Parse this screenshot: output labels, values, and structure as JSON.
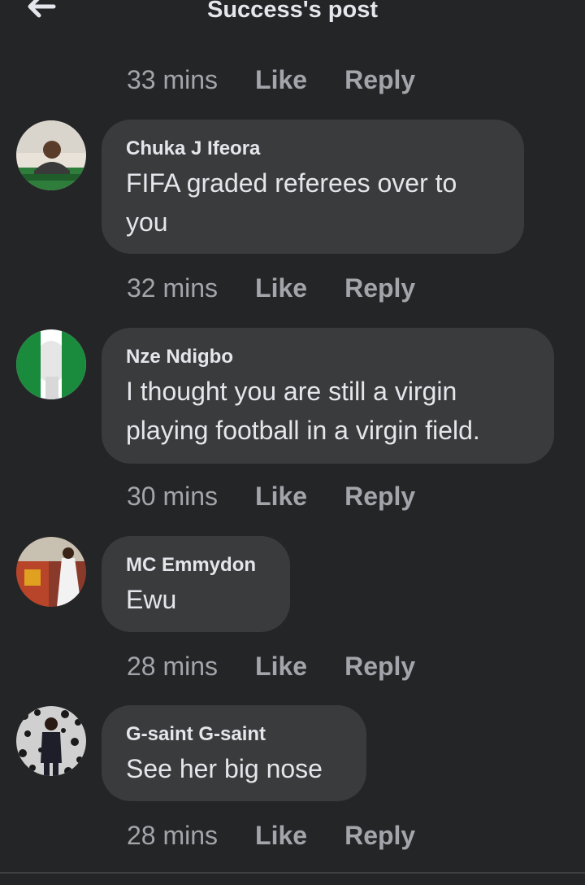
{
  "header": {
    "title": "Success's post",
    "back_icon": "arrow-left-icon"
  },
  "top_meta": {
    "time": "33 mins",
    "like": "Like",
    "reply": "Reply"
  },
  "comments": [
    {
      "author": "Chuka J Ifeora",
      "text_lines": [
        "FIFA graded referees over to",
        "you"
      ],
      "time": "32 mins",
      "like": "Like",
      "reply": "Reply"
    },
    {
      "author": "Nze Ndigbo",
      "text_lines": [
        "I thought you are still a virgin",
        "playing football in a virgin field."
      ],
      "time": "30 mins",
      "like": "Like",
      "reply": "Reply"
    },
    {
      "author": "MC Emmydon",
      "text_lines": [
        "Ewu"
      ],
      "time": "28 mins",
      "like": "Like",
      "reply": "Reply"
    },
    {
      "author": "G-saint G-saint",
      "text_lines": [
        "See her big nose"
      ],
      "time": "28 mins",
      "like": "Like",
      "reply": "Reply"
    }
  ],
  "colors": {
    "background": "#242527",
    "bubble": "#3a3b3c",
    "text_primary": "#e4e6eb",
    "text_secondary": "#a2a5aa"
  }
}
